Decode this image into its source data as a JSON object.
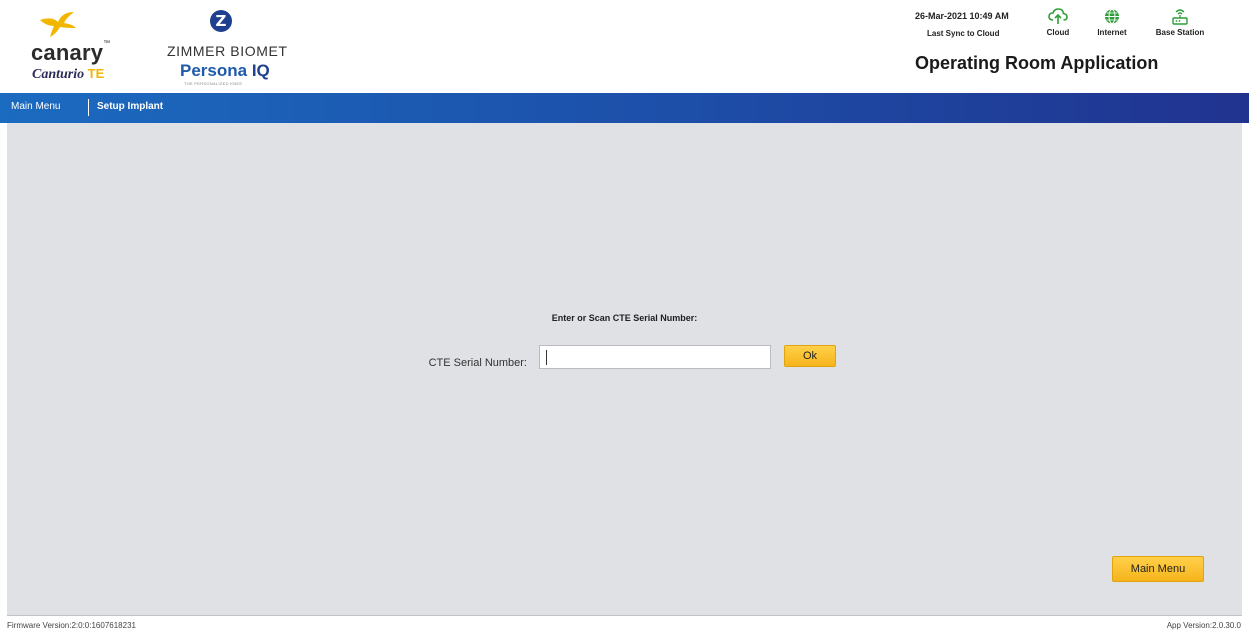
{
  "header": {
    "canary_logo": {
      "word": "canary",
      "tm": "™",
      "product": "Canturio",
      "product_suffix": "TE"
    },
    "zimmer_logo": {
      "mark": "Z",
      "name": "ZIMMER BIOMET",
      "persona": "Persona",
      "persona_iq": "IQ",
      "persona_sub": "THE PERSONALIZED KNEE"
    },
    "datetime": "26-Mar-2021 10:49 AM",
    "last_sync_label": "Last Sync to Cloud",
    "status": [
      {
        "label": "Cloud",
        "icon": "cloud-upload-icon"
      },
      {
        "label": "Internet",
        "icon": "globe-icon"
      },
      {
        "label": "Base Station",
        "icon": "router-icon"
      }
    ],
    "app_title": "Operating Room Application"
  },
  "nav": {
    "main_menu": "Main Menu",
    "setup_implant": "Setup Implant"
  },
  "form": {
    "prompt": "Enter or Scan CTE Serial Number:",
    "serial_label": "CTE Serial Number:",
    "serial_value": "",
    "ok_label": "Ok"
  },
  "buttons": {
    "main_menu": "Main Menu"
  },
  "footer": {
    "firmware": "Firmware Version:2:0:0:1607618231",
    "app_version": "App Version:2.0.30.0"
  },
  "colors": {
    "accent_yellow": "#f6b41b",
    "nav_blue": "#1d4ea8",
    "status_green": "#2e9e3a",
    "content_bg": "#dfe1e5"
  }
}
